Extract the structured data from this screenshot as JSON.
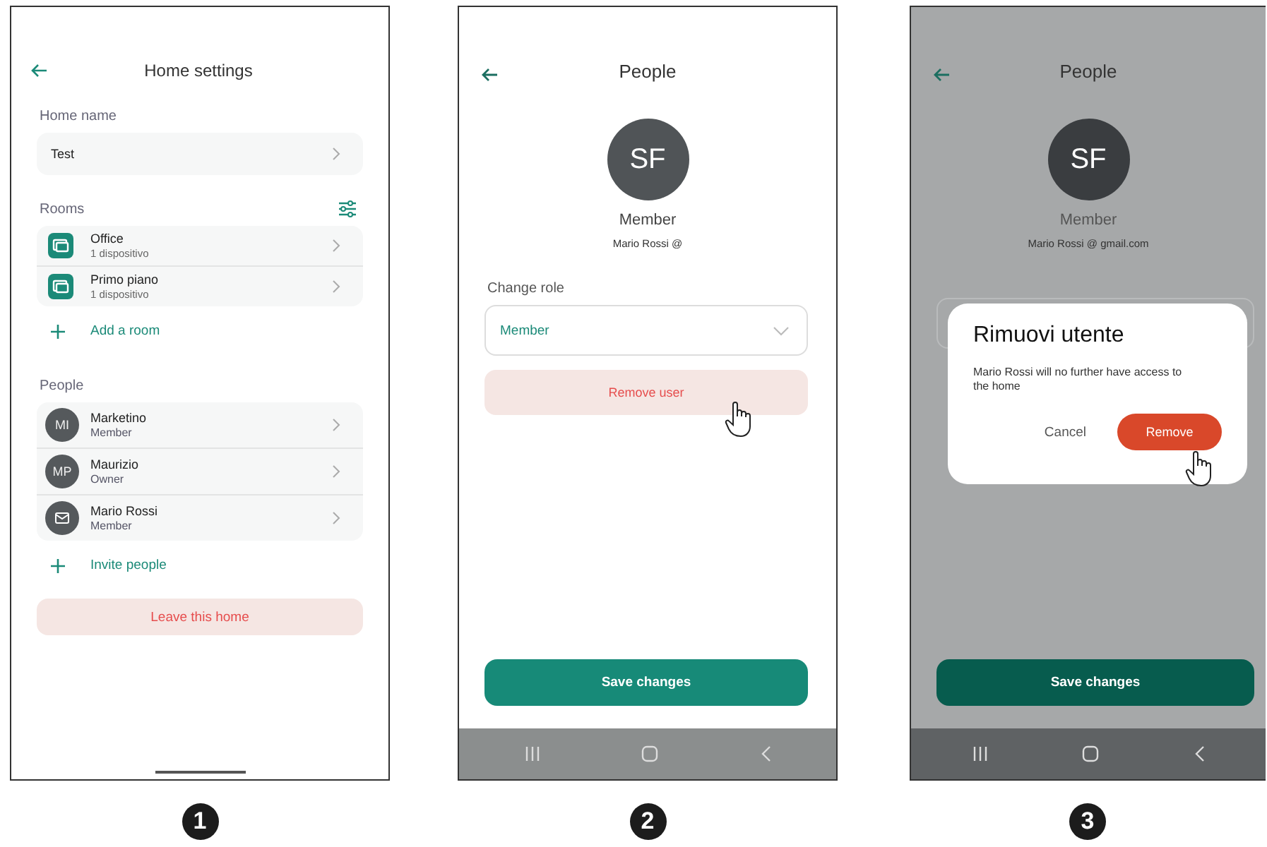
{
  "screens": [
    {
      "kind": "home_settings",
      "step": "1",
      "title": "Home settings",
      "home_name_label": "Home name",
      "home_name": "Test",
      "rooms_label": "Rooms",
      "rooms": [
        {
          "name": "Office",
          "detail": "1 dispositivo"
        },
        {
          "name": "Primo piano",
          "detail": "1 dispositivo"
        }
      ],
      "add_room": "Add a room",
      "people_label": "People",
      "people": [
        {
          "kind": "initials",
          "initials": "MI",
          "name": "Marketino",
          "role": "Member"
        },
        {
          "kind": "initials",
          "initials": "MP",
          "name": "Maurizio",
          "role": "Owner"
        },
        {
          "kind": "invite",
          "name": "Mario Rossi",
          "role": "Member"
        }
      ],
      "invite": "Invite people",
      "leave": "Leave this home"
    },
    {
      "kind": "person",
      "step": "2",
      "title": "People",
      "initials": "SF",
      "role": "Member",
      "email": "Mario Rossi @",
      "change_role_label": "Change role",
      "role_value": "Member",
      "remove": "Remove user",
      "save": "Save changes"
    },
    {
      "kind": "person_dialog",
      "step": "3",
      "title": "People",
      "initials": "SF",
      "role": "Member",
      "email": "Mario Rossi @ gmail.com",
      "dialog_title": "Rimuovi utente",
      "dialog_message": "Mario Rossi will no further have access to the home",
      "cancel": "Cancel",
      "confirm": "Remove",
      "save": "Save changes"
    }
  ]
}
